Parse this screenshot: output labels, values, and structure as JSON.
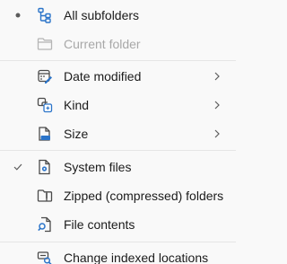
{
  "colors": {
    "background": "#f9f9f9",
    "text": "#1b1b1b",
    "disabled_text": "#a8a8a8",
    "icon_blue": "#2b74c9",
    "icon_dark": "#4a4a4a",
    "separator": "#e6e6e6"
  },
  "scope": {
    "items": [
      {
        "label": "All subfolders",
        "icon": "folder-tree-icon",
        "selected": true,
        "disabled": false
      },
      {
        "label": "Current folder",
        "icon": "folder-icon",
        "selected": false,
        "disabled": true
      }
    ]
  },
  "filters": {
    "items": [
      {
        "label": "Date modified",
        "icon": "calendar-edit-icon",
        "submenu": true
      },
      {
        "label": "Kind",
        "icon": "kind-icon",
        "submenu": true
      },
      {
        "label": "Size",
        "icon": "size-icon",
        "submenu": true
      }
    ]
  },
  "options": {
    "items": [
      {
        "label": "System files",
        "icon": "system-file-icon",
        "checked": true
      },
      {
        "label": "Zipped (compressed) folders",
        "icon": "zipped-folder-icon",
        "checked": false
      },
      {
        "label": "File contents",
        "icon": "file-search-icon",
        "checked": false
      }
    ]
  },
  "footer": {
    "items": [
      {
        "label": "Change indexed locations",
        "icon": "indexed-locations-icon"
      }
    ]
  }
}
